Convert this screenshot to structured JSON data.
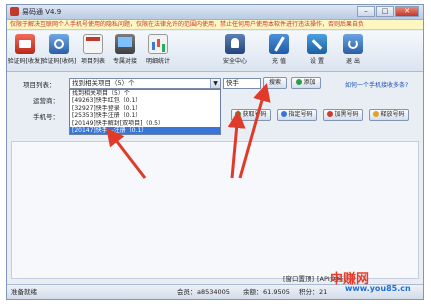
{
  "window": {
    "title": "易码通 V4.9",
    "minimize": "–",
    "maximize": "□",
    "close": "✕"
  },
  "banner": "仅限于解决互联网个人手机号使用的隐私问题，仅限在法律允许的范围内使用，禁止任何用户使用本软件进行违法操作，否则后果自负",
  "toolbar": [
    {
      "label": "验证码[收发]",
      "icon": "sms-icon"
    },
    {
      "label": "验证码[收码]",
      "icon": "receive-icon"
    },
    {
      "label": "项目列表",
      "icon": "list-icon"
    },
    {
      "label": "专属对接",
      "icon": "connect-icon"
    },
    {
      "label": "明细统计",
      "icon": "stats-icon"
    },
    {
      "label": "安全中心",
      "icon": "security-icon"
    },
    {
      "label": "充 值",
      "icon": "recharge-icon"
    },
    {
      "label": "设 置",
      "icon": "settings-icon"
    },
    {
      "label": "退 出",
      "icon": "exit-icon"
    }
  ],
  "form": {
    "project_label": "项目列表：",
    "project_selected": "找到相关项目（5）个",
    "operator_label": "运营商：",
    "phone_label": "手机号：",
    "search_value": "快手",
    "search_button": "搜索",
    "add_button": "添加",
    "help_link": "如何一个手机接收多条?"
  },
  "dropdown_options": [
    "找到相关项目（5）个",
    "[49263]快手红包（0.1）",
    "[32927]快手登录（0.1）",
    "[25353]快手注册（0.1）",
    "[20149]快手解封[双项目]（0.5）",
    "[20147]快手—注册（0.1）"
  ],
  "actions": {
    "get_number": "获取号码",
    "assign_number": "指定号码",
    "blacklist_number": "加黑号码",
    "release_number": "释放号码"
  },
  "statusbar": {
    "status": "准备就绪",
    "member_label": "会员：",
    "member_id": "a8534005",
    "balance_label": "余额：",
    "balance_value": "61.9505",
    "score_label": "积分：",
    "score_value": "21",
    "links": [
      "[窗口置顶]",
      "[API文档]"
    ]
  },
  "watermark": {
    "cn": "中赚网",
    "url": "www.you85.cn"
  },
  "colors": {
    "accent": "#3875d7",
    "arrow": "#e03a2a",
    "watermark_red": "#e53d2c",
    "watermark_blue": "#1d6fd6"
  }
}
